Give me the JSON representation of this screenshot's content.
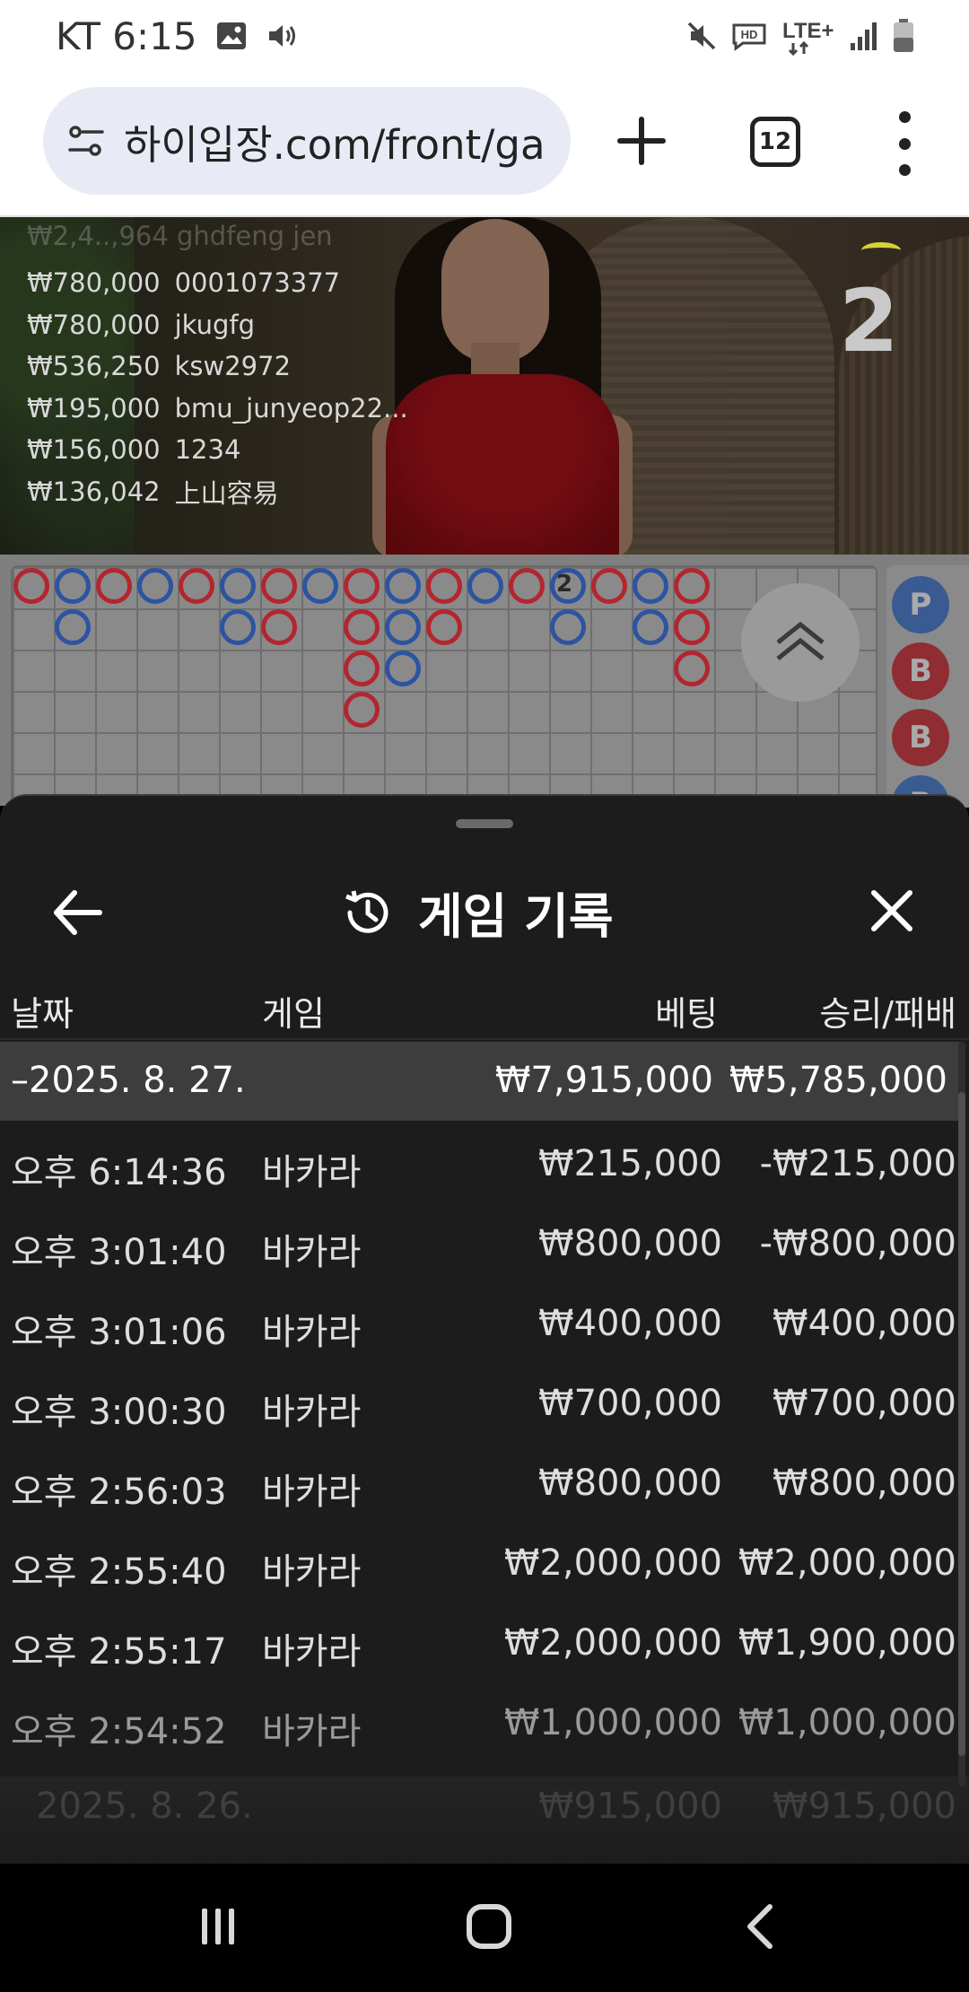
{
  "status_bar": {
    "carrier_time": "KT 6:15",
    "network_label": "LTE+",
    "hd_label": "HD",
    "icons": [
      "image-icon",
      "volume-icon",
      "mute-icon",
      "hd-voice-icon",
      "lte-plus-icon",
      "signal-icon",
      "battery-icon"
    ]
  },
  "browser": {
    "url": "하이입장.com/front/game",
    "tab_count": "12",
    "icons": [
      "site-settings-icon",
      "plus-icon",
      "tab-switcher-icon",
      "more-vert-icon"
    ]
  },
  "live": {
    "round_number": "2",
    "faded_top_entry": "₩2,4..,964 ghdfeng jen",
    "winners": [
      {
        "amount": "₩780,000",
        "user": "0001073377"
      },
      {
        "amount": "₩780,000",
        "user": "jkugfg"
      },
      {
        "amount": "₩536,250",
        "user": "ksw2972"
      },
      {
        "amount": "₩195,000",
        "user": "bmu_junyeop22..."
      },
      {
        "amount": "₩156,000",
        "user": "1234"
      },
      {
        "amount": "₩136,042",
        "user": "上山容易"
      }
    ]
  },
  "scoreboard": {
    "marker_label": "2",
    "road_labels": [
      "P",
      "B",
      "B",
      "P"
    ],
    "colors": {
      "banker": "#b3262e",
      "player": "#2c54a0"
    }
  },
  "sheet": {
    "title": "게임 기록",
    "columns": {
      "date": "날짜",
      "game": "게임",
      "bet": "베팅",
      "win_loss": "승리/패배"
    },
    "date_group": {
      "date": "–2025. 8. 27.",
      "bet_total": "₩7,915,000",
      "win_total": "₩5,785,000"
    },
    "rows": [
      {
        "time": "오후 6:14:36",
        "game": "바카라",
        "bet": "₩215,000",
        "result": "-₩215,000"
      },
      {
        "time": "오후 3:01:40",
        "game": "바카라",
        "bet": "₩800,000",
        "result": "-₩800,000"
      },
      {
        "time": "오후 3:01:06",
        "game": "바카라",
        "bet": "₩400,000",
        "result": "₩400,000"
      },
      {
        "time": "오후 3:00:30",
        "game": "바카라",
        "bet": "₩700,000",
        "result": "₩700,000"
      },
      {
        "time": "오후 2:56:03",
        "game": "바카라",
        "bet": "₩800,000",
        "result": "₩800,000"
      },
      {
        "time": "오후 2:55:40",
        "game": "바카라",
        "bet": "₩2,000,000",
        "result": "₩2,000,000"
      },
      {
        "time": "오후 2:55:17",
        "game": "바카라",
        "bet": "₩2,000,000",
        "result": "₩1,900,000"
      },
      {
        "time": "오후 2:54:52",
        "game": "바카라",
        "bet": "₩1,000,000",
        "result": "₩1,000,000"
      }
    ],
    "ghost_row": {
      "date": "2025. 8. 26.",
      "bet": "₩915,000",
      "result": "₩915,000"
    },
    "icons": [
      "back-arrow-icon",
      "history-icon",
      "close-icon"
    ]
  },
  "nav_bar": {
    "icons": [
      "recents-icon",
      "home-icon",
      "back-icon"
    ]
  }
}
